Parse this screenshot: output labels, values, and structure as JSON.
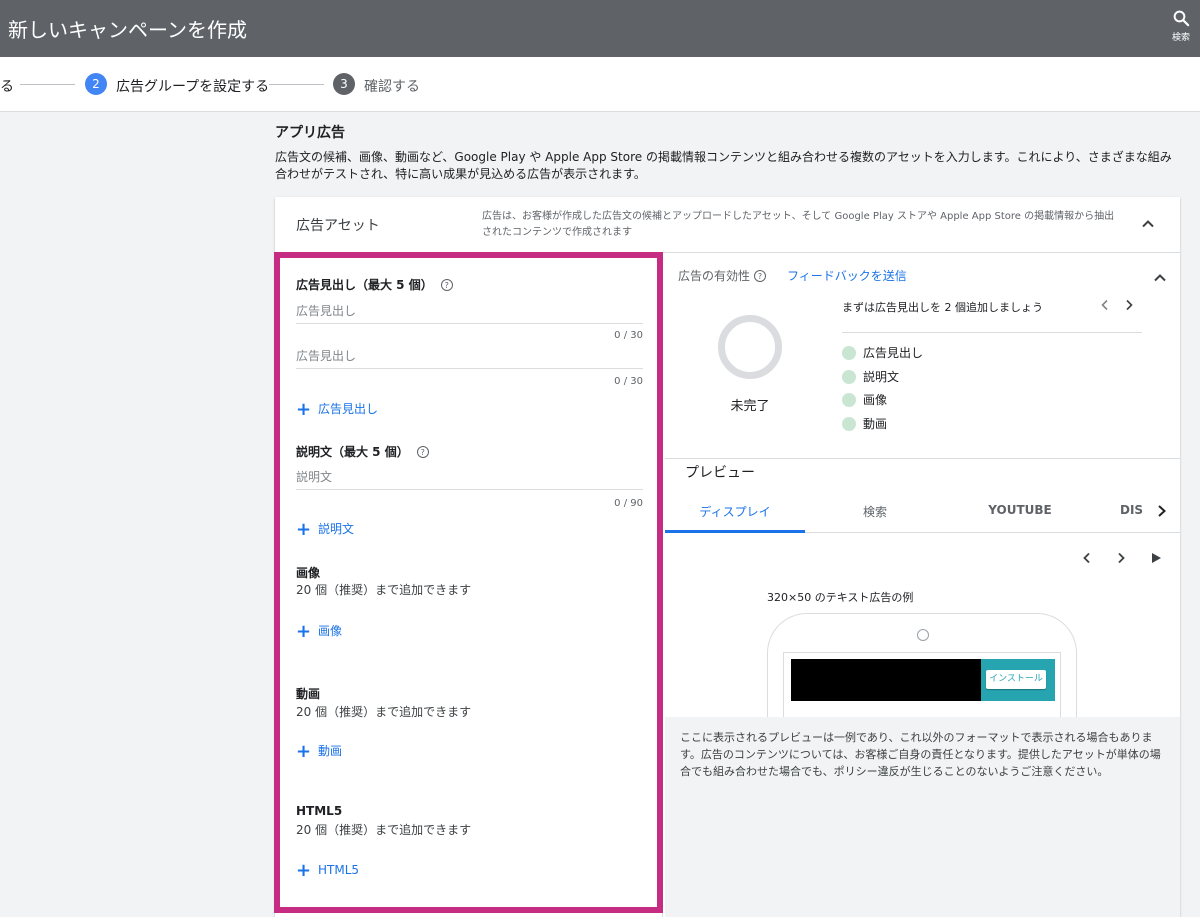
{
  "header": {
    "title": "新しいキャンペーンを作成",
    "search_label": "検索"
  },
  "stepper": {
    "prev_label": "る",
    "steps": [
      {
        "number": "2",
        "label": "広告グループを設定する",
        "active": true,
        "color": "#4285f4"
      },
      {
        "number": "3",
        "label": "確認する",
        "active": false,
        "color": "#5f6368"
      }
    ]
  },
  "intro": {
    "title": "アプリ広告",
    "description": "広告文の候補、画像、動画など、Google Play や Apple App Store の掲載情報コンテンツと組み合わせる複数のアセットを入力します。これにより、さまざまな組み合わせがテストされ、特に高い成果が見込める広告が表示されます。"
  },
  "assets_card": {
    "title": "広告アセット",
    "description": "広告は、お客様が作成した広告文の候補とアップロードしたアセット、そして Google Play ストアや Apple App Store の掲載情報から抽出されたコンテンツで作成されます"
  },
  "form": {
    "headlines": {
      "label": "広告見出し（最大 5 個）",
      "fields": [
        {
          "placeholder": "広告見出し",
          "counter": "0 / 30"
        },
        {
          "placeholder": "広告見出し",
          "counter": "0 / 30"
        }
      ],
      "add_label": "広告見出し"
    },
    "descriptions": {
      "label": "説明文（最大 5 個）",
      "fields": [
        {
          "placeholder": "説明文",
          "counter": "0 / 90"
        }
      ],
      "add_label": "説明文"
    },
    "images": {
      "label": "画像",
      "hint": "20 個（推奨）まで追加できます",
      "add_label": "画像"
    },
    "videos": {
      "label": "動画",
      "hint": "20 個（推奨）まで追加できます",
      "add_label": "動画"
    },
    "html5": {
      "label": "HTML5",
      "hint": "20 個（推奨）まで追加できます",
      "add_label": "HTML5"
    }
  },
  "ad_strength": {
    "title": "広告の有効性",
    "feedback_link": "フィードバックを送信",
    "status": "未完了",
    "tip": "まずは広告見出しを 2 個追加しましょう",
    "checklist": [
      "広告見出し",
      "説明文",
      "画像",
      "動画"
    ]
  },
  "preview": {
    "title": "プレビュー",
    "tabs": [
      "ディスプレイ",
      "検索",
      "YOUTUBE",
      "DIS"
    ],
    "caption": "320×50 のテキスト広告の例",
    "install_label": "インストール",
    "disclaimer": "ここに表示されるプレビューは一例であり、これ以外のフォーマットで表示される場合もあります。広告のコンテンツについては、お客様ご自身の責任となります。提供したアセットが単体の場合でも組み合わせた場合でも、ポリシー違反が生じることのないようご注意ください。"
  },
  "colors": {
    "header_bg": "#5f6368",
    "accent": "#1a73e8",
    "highlight": "#c62d82",
    "cta_teal": "#26a4b0",
    "check_green": "#c8e6d2"
  }
}
